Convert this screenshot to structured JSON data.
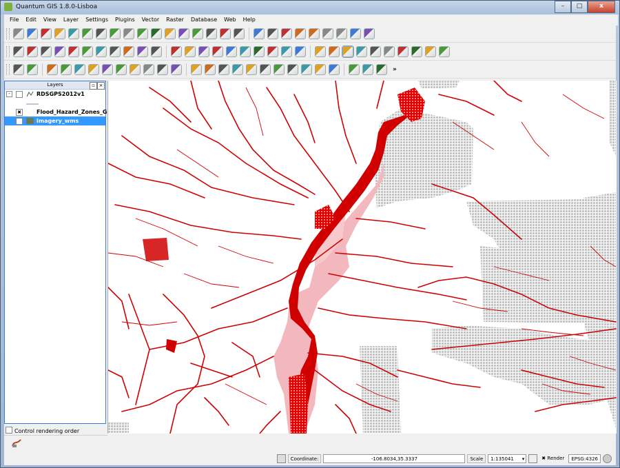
{
  "window": {
    "title": "Quantum GIS 1.8.0-Lisboa",
    "buttons": [
      "–",
      "□",
      "x"
    ]
  },
  "menu": [
    "File",
    "Edit",
    "View",
    "Layer",
    "Settings",
    "Plugins",
    "Vector",
    "Raster",
    "Database",
    "Web",
    "Help"
  ],
  "toolbar": {
    "row1_icons": [
      "new-project-icon",
      "open-project-icon",
      "save-project-icon",
      "save-as-icon",
      "new-print-composer-icon",
      "print-composer-manager-icon",
      "add-vector-layer-icon",
      "add-raster-layer-icon",
      "add-postgis-layer-icon",
      "add-spatialite-layer-icon",
      "add-wms-layer-icon",
      "add-wcs-layer-icon",
      "add-wfs-layer-icon",
      "add-delimited-text-icon",
      "remove-layer-icon",
      "new-shapefile-icon",
      "add-oracle-layer-icon",
      "toggle-editing-icon",
      "save-edits-icon",
      "add-feature-icon",
      "move-feature-icon",
      "node-tool-icon",
      "delete-selected-icon",
      "cut-features-icon",
      "copy-features-icon",
      "paste-features-icon"
    ],
    "row2_icons": [
      "identify-layer-icon",
      "select-features-icon",
      "deselect-icon",
      "open-attribute-table-icon",
      "field-calculator-icon",
      "measure-line-icon",
      "measure-area-icon",
      "measure-angle-icon",
      "map-tips-icon",
      "new-bookmark-icon",
      "show-bookmarks-icon",
      "text-annotation-icon",
      "label-tool-icon",
      "pin-labels-icon",
      "show-hide-labels-icon",
      "move-label-icon",
      "rotate-label-icon",
      "change-label-icon",
      "layer-labeling-icon",
      "gps-icon",
      "grass-icon",
      "pan-icon",
      "pan-to-selection-icon",
      "zoom-in-icon",
      "zoom-out-icon",
      "zoom-full-icon",
      "zoom-to-layer-icon",
      "zoom-to-selection-icon",
      "zoom-last-icon",
      "zoom-next-icon",
      "refresh-icon"
    ],
    "row3_icons": [
      "undo-icon",
      "redo-icon",
      "simplify-feature-icon",
      "add-ring-icon",
      "add-part-icon",
      "delete-ring-icon",
      "delete-part-icon",
      "reshape-features-icon",
      "offset-curve-icon",
      "split-features-icon",
      "merge-features-icon",
      "merge-attributes-icon",
      "rotate-point-symbols-icon",
      "capture-point-icon",
      "capture-line-icon",
      "capture-polygon-icon",
      "coordinate-capture-icon",
      "georeferencer-icon",
      "interpolation-icon",
      "heatmap-icon",
      "road-graph-icon",
      "spatial-query-icon",
      "text-tool-icon",
      "plugin-a-icon",
      "plugin-b-icon",
      "plugin-c-icon"
    ],
    "more_label": "»"
  },
  "layers_panel": {
    "title": "Layers",
    "layers": [
      {
        "name": "RDSGPS2012v1",
        "checked": false
      },
      {
        "name": "Flood_Hazard_Zones_Ge...",
        "checked": true
      },
      {
        "name": "imagery_wms",
        "checked": false
      }
    ],
    "control_rendering_order": "Control rendering order"
  },
  "statusbar": {
    "coordinate_label": "Coordinate:",
    "coordinate_value": "-106.8034,35.3337",
    "scale_label": "Scale",
    "scale_value": "1:135041",
    "render_label": "Render",
    "crs_label": "EPSG:4326"
  },
  "colors": {
    "flood_dark": "#d40000",
    "flood_light": "#f2b9bd",
    "gray_fill": "#c9c9c9",
    "selected_row": "#3399ff"
  }
}
